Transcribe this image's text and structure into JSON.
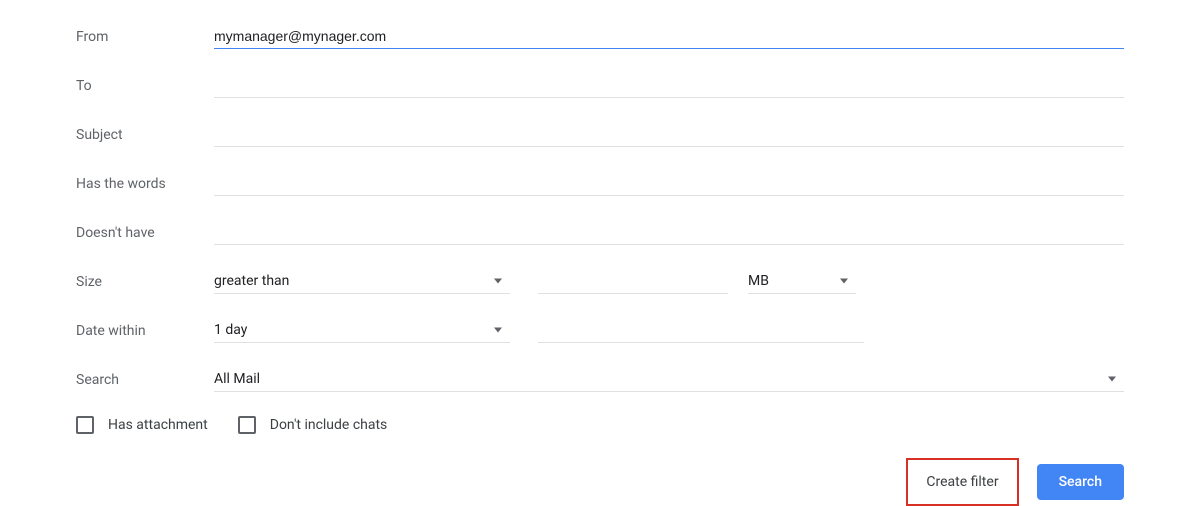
{
  "labels": {
    "from": "From",
    "to": "To",
    "subject": "Subject",
    "hasWords": "Has the words",
    "doesntHave": "Doesn't have",
    "size": "Size",
    "dateWithin": "Date within",
    "search": "Search"
  },
  "values": {
    "from": "mymanager@mynager.com",
    "to": "",
    "subject": "",
    "hasWords": "",
    "doesntHave": "",
    "sizeOperator": "greater than",
    "sizeValue": "",
    "sizeUnit": "MB",
    "dateRange": "1 day",
    "dateValue": "",
    "searchIn": "All Mail"
  },
  "checkboxes": {
    "hasAttachment": "Has attachment",
    "dontIncludeChats": "Don't include chats"
  },
  "actions": {
    "createFilter": "Create filter",
    "search": "Search"
  }
}
